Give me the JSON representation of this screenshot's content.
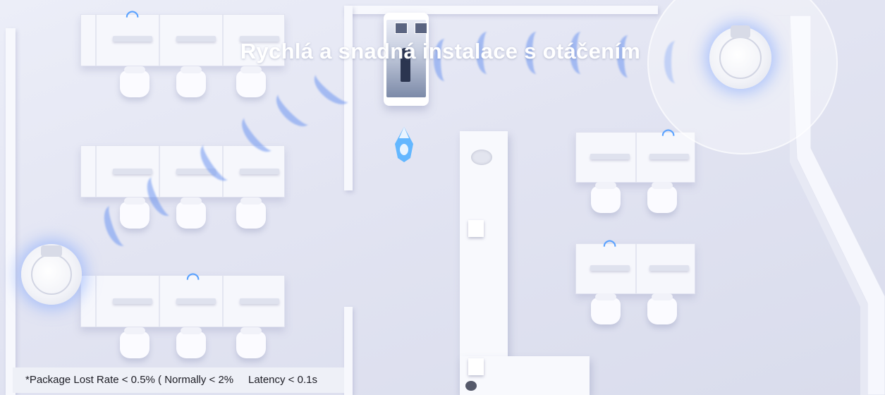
{
  "banner": {
    "title": "Rychlá a snadná instalace s otáčením"
  },
  "footnote": {
    "text": "*Package Lost Rate < 0.5% ( Normally < 2%     Latency < 0.1s"
  },
  "colors": {
    "wifi": "#5aa2ff",
    "signal_wave": "#6e96f0",
    "background": "#e2e4f2",
    "title_text": "#ffffff"
  },
  "icons": {
    "wifi": "wifi-icon",
    "access_point": "ceiling-access-point-icon",
    "robot": "delivery-robot-icon",
    "phone": "smartphone-icon"
  }
}
